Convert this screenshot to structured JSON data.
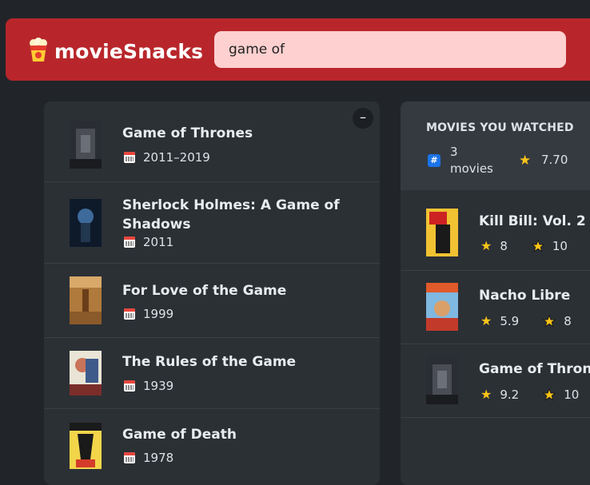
{
  "app": {
    "name": "movieSnacks"
  },
  "search": {
    "value": "game of"
  },
  "results": {
    "toggle_label": "–",
    "items": [
      {
        "title": "Game of Thrones",
        "year": "2011–2019"
      },
      {
        "title": "Sherlock Holmes: A Game of",
        "title2": "Shadows",
        "year": "2011"
      },
      {
        "title": "For Love of the Game",
        "year": "1999"
      },
      {
        "title": "The Rules of the Game",
        "year": "1939"
      },
      {
        "title": "Game of Death",
        "year": "1978"
      }
    ]
  },
  "watched": {
    "heading": "MOVIES YOU WATCHED",
    "count_line1": "3",
    "count_line2": "movies",
    "avg_rating": "7.70",
    "items": [
      {
        "title": "Kill Bill: Vol. 2",
        "imdb": "8",
        "user": "10"
      },
      {
        "title": "Nacho Libre",
        "imdb": "5.9",
        "user": "8"
      },
      {
        "title": "Game of Thrones",
        "imdb": "9.2",
        "user": "10"
      }
    ]
  },
  "colors": {
    "brand": "#b8262b",
    "search_bg": "#ffd0d0",
    "star": "#fcc419"
  }
}
